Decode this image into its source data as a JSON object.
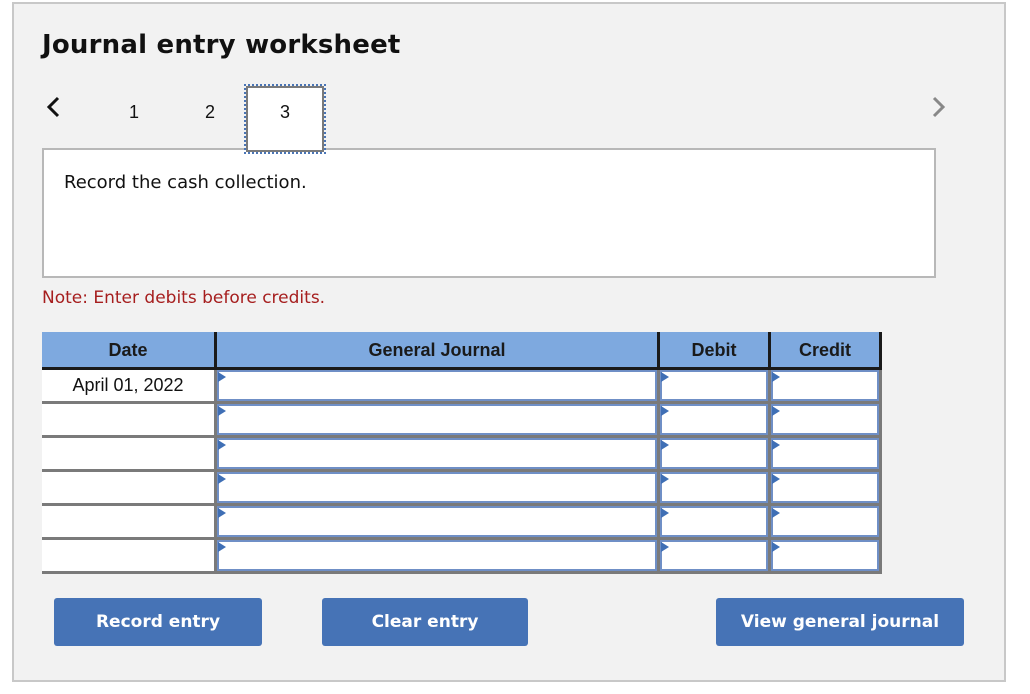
{
  "worksheet": {
    "title": "Journal entry worksheet",
    "tabs": [
      {
        "label": "1",
        "active": false
      },
      {
        "label": "2",
        "active": false
      },
      {
        "label": "3",
        "active": true
      }
    ],
    "icons": {
      "prev": "chevron-left-icon",
      "next": "chevron-right-icon"
    },
    "prompt": "Record the cash collection.",
    "note": "Note: Enter debits before credits."
  },
  "table": {
    "headers": [
      "Date",
      "General Journal",
      "Debit",
      "Credit"
    ],
    "rows": [
      {
        "date": "April 01, 2022",
        "account": "",
        "debit": "",
        "credit": ""
      },
      {
        "date": "",
        "account": "",
        "debit": "",
        "credit": ""
      },
      {
        "date": "",
        "account": "",
        "debit": "",
        "credit": ""
      },
      {
        "date": "",
        "account": "",
        "debit": "",
        "credit": ""
      },
      {
        "date": "",
        "account": "",
        "debit": "",
        "credit": ""
      },
      {
        "date": "",
        "account": "",
        "debit": "",
        "credit": ""
      }
    ]
  },
  "buttons": {
    "record": "Record entry",
    "clear": "Clear entry",
    "view": "View general journal"
  },
  "colors": {
    "header_bg": "#7ea9df",
    "button_bg": "#4673b6",
    "note_text": "#a61e1e",
    "panel_bg": "#f2f2f2"
  }
}
